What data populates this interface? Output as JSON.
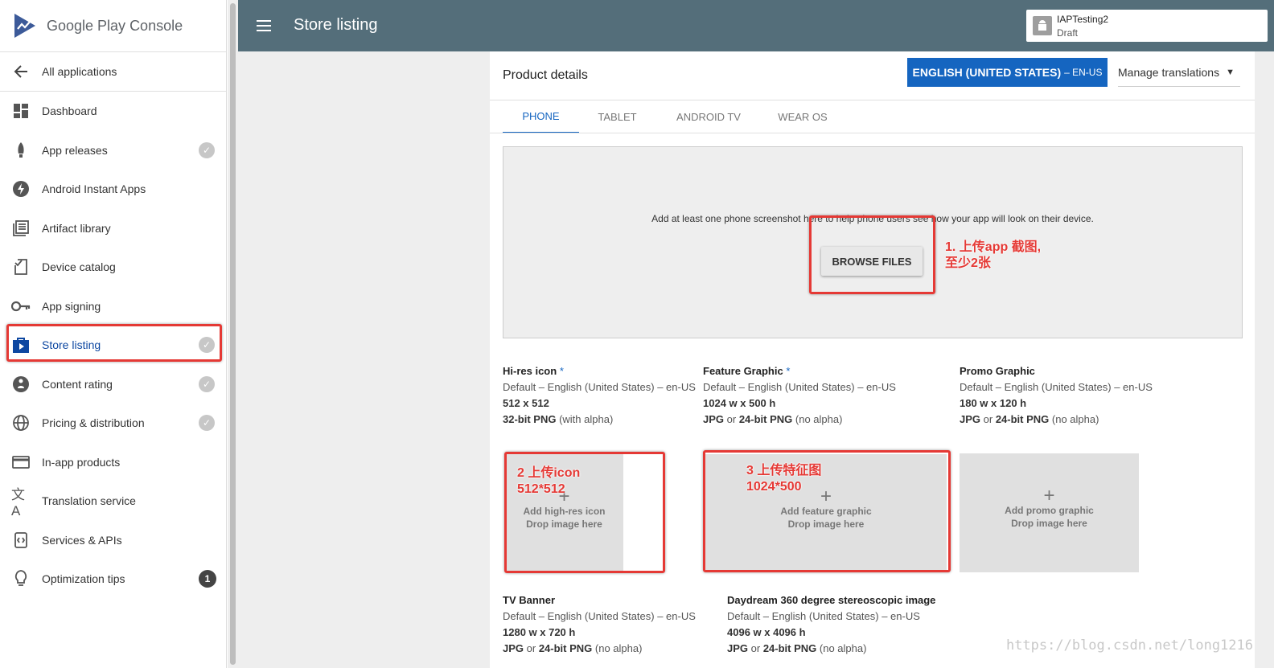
{
  "brand": {
    "name_prefix": "Google Play ",
    "name_suffix": "Console"
  },
  "sidebar": {
    "back_label": "All applications",
    "items": [
      {
        "label": "Dashboard",
        "icon": "dashboard-icon"
      },
      {
        "label": "App releases",
        "icon": "rocket-icon",
        "status": "check"
      },
      {
        "label": "Android Instant Apps",
        "icon": "bolt-icon"
      },
      {
        "label": "Artifact library",
        "icon": "library-icon"
      },
      {
        "label": "Device catalog",
        "icon": "device-icon"
      },
      {
        "label": "App signing",
        "icon": "key-icon"
      },
      {
        "label": "Store listing",
        "icon": "store-icon",
        "status": "check",
        "active": true
      },
      {
        "label": "Content rating",
        "icon": "rating-icon",
        "status": "check"
      },
      {
        "label": "Pricing & distribution",
        "icon": "globe-icon",
        "status": "check"
      },
      {
        "label": "In-app products",
        "icon": "card-icon"
      },
      {
        "label": "Translation service",
        "icon": "translate-icon"
      },
      {
        "label": "Services & APIs",
        "icon": "api-icon"
      },
      {
        "label": "Optimization tips",
        "icon": "lightbulb-icon",
        "badge": "1"
      }
    ]
  },
  "header": {
    "title": "Store listing"
  },
  "app": {
    "name": "IAPTesting2",
    "status": "Draft"
  },
  "product": {
    "title": "Product details",
    "language": "ENGLISH (UNITED STATES)",
    "language_code": "– EN-US",
    "manage_translations": "Manage translations",
    "tabs": [
      "PHONE",
      "TABLET",
      "ANDROID TV",
      "WEAR OS"
    ],
    "active_tab": "PHONE"
  },
  "screenshots": {
    "message": "Add at least one phone screenshot here to help phone users see how your app will look on their device.",
    "browse_label": "BROWSE FILES"
  },
  "annotations": {
    "note1_line1": "1. 上传app 截图,",
    "note1_line2": "至少2张",
    "note2_line1": "2 上传icon",
    "note2_line2": "512*512",
    "note3_line1": "3 上传特征图",
    "note3_line2": "1024*500"
  },
  "graphics": [
    {
      "title": "Hi-res icon",
      "required": "*",
      "lang": "Default – English (United States) – en-US",
      "size": "512 x 512",
      "fmt_bold": "32-bit PNG",
      "fmt_rest": " (with alpha)",
      "tile_line1": "Add high-res icon",
      "tile_line2": "Drop image here"
    },
    {
      "title": "Feature Graphic",
      "required": "*",
      "lang": "Default – English (United States) – en-US",
      "size": "1024 w x 500 h",
      "fmt_bold": "JPG",
      "fmt_mid": " or ",
      "fmt_bold2": "24-bit PNG",
      "fmt_rest": " (no alpha)",
      "tile_line1": "Add feature graphic",
      "tile_line2": "Drop image here"
    },
    {
      "title": "Promo Graphic",
      "lang": "Default – English (United States) – en-US",
      "size": "180 w x 120 h",
      "fmt_bold": "JPG",
      "fmt_mid": " or ",
      "fmt_bold2": "24-bit PNG",
      "fmt_rest": " (no alpha)",
      "tile_line1": "Add promo graphic",
      "tile_line2": "Drop image here"
    },
    {
      "title": "TV Banner",
      "lang": "Default – English (United States) – en-US",
      "size": "1280 w x 720 h",
      "fmt_bold": "JPG",
      "fmt_mid": " or ",
      "fmt_bold2": "24-bit PNG",
      "fmt_rest": " (no alpha)"
    },
    {
      "title": "Daydream 360 degree stereoscopic image",
      "lang": "Default – English (United States) – en-US",
      "size": "4096 w x 4096 h",
      "fmt_bold": "JPG",
      "fmt_mid": " or ",
      "fmt_bold2": "24-bit PNG",
      "fmt_rest": " (no alpha)"
    }
  ],
  "watermark": "https://blog.csdn.net/long1216",
  "colors": {
    "header": "#546e7a",
    "accent": "#1565c0",
    "annotation": "#e53935"
  }
}
